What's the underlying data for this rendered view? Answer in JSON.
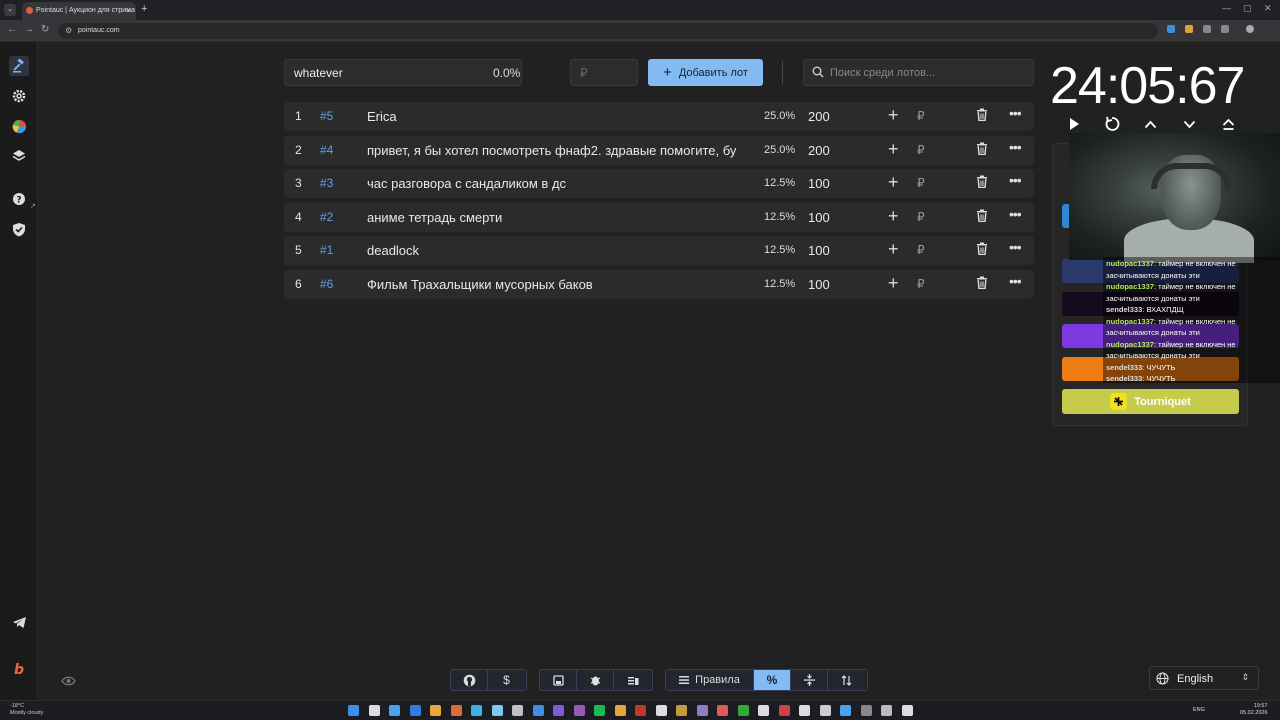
{
  "browser": {
    "tab_title": "Pointauc | Аукцион для стрима",
    "url": "pointauc.com"
  },
  "toolbar": {
    "lot_name_value": "whatever",
    "percent": "0.0%",
    "amount_placeholder": "₽",
    "add_button_label": "Добавить лот",
    "search_placeholder": "Поиск среди лотов..."
  },
  "lots": [
    {
      "num": "1",
      "id": "#5",
      "name": "Erica",
      "percent": "25.0%",
      "amount": "200",
      "currency": "₽"
    },
    {
      "num": "2",
      "id": "#4",
      "name": "привет, я бы хотел посмотреть фнаф2. здравые помогите, бу",
      "percent": "25.0%",
      "amount": "200",
      "currency": "₽"
    },
    {
      "num": "3",
      "id": "#3",
      "name": "час разговора с сандаликом в дс",
      "percent": "12.5%",
      "amount": "100",
      "currency": "₽"
    },
    {
      "num": "4",
      "id": "#2",
      "name": "аниме тетрадь смерти",
      "percent": "12.5%",
      "amount": "100",
      "currency": "₽"
    },
    {
      "num": "5",
      "id": "#1",
      "name": "deadlock",
      "percent": "12.5%",
      "amount": "100",
      "currency": "₽"
    },
    {
      "num": "6",
      "id": "#6",
      "name": "Фильм Трахальщики мусорных баков",
      "percent": "12.5%",
      "amount": "100",
      "currency": "₽"
    }
  ],
  "timer": {
    "display": "24:05:67"
  },
  "integrations": {
    "tourniquet_label": "Tourniquet",
    "colors": {
      "twitch": "#7c3ae0",
      "donation_alerts": "#ef7d16",
      "tourniquet": "#c6cb4c",
      "primary": "#84baf2"
    }
  },
  "chat": [
    {
      "user": "nudopac1337",
      "text": ": таймер не включен не засчитываются донаты эти",
      "kind": "u1"
    },
    {
      "user": "nudopac1337",
      "text": ": таймер не включен не засчитываются донаты эти",
      "kind": "u1"
    },
    {
      "user": "sendel333",
      "text": ": ВХАХПДЩ",
      "kind": "u2"
    },
    {
      "user": "nudopac1337",
      "text": ": таймер не включен не засчитываются донаты эти",
      "kind": "u1"
    },
    {
      "user": "nudopac1337",
      "text": ": таймер не включен не засчитываются донаты эти",
      "kind": "u1"
    },
    {
      "user": "sendel333",
      "text": ": ЧУЧУТЬ",
      "kind": "u2"
    },
    {
      "user": "sendel333",
      "text": ": ЧУЧУТЬ",
      "kind": "u2"
    }
  ],
  "bottom": {
    "rules_label": "Правила"
  },
  "language": {
    "selected": "English"
  },
  "taskbar": {
    "temperature": "-18°C",
    "weather": "Mostly cloudy",
    "keyboard_lang": "ENG",
    "time": "19:57",
    "date": "05.02.2026"
  }
}
